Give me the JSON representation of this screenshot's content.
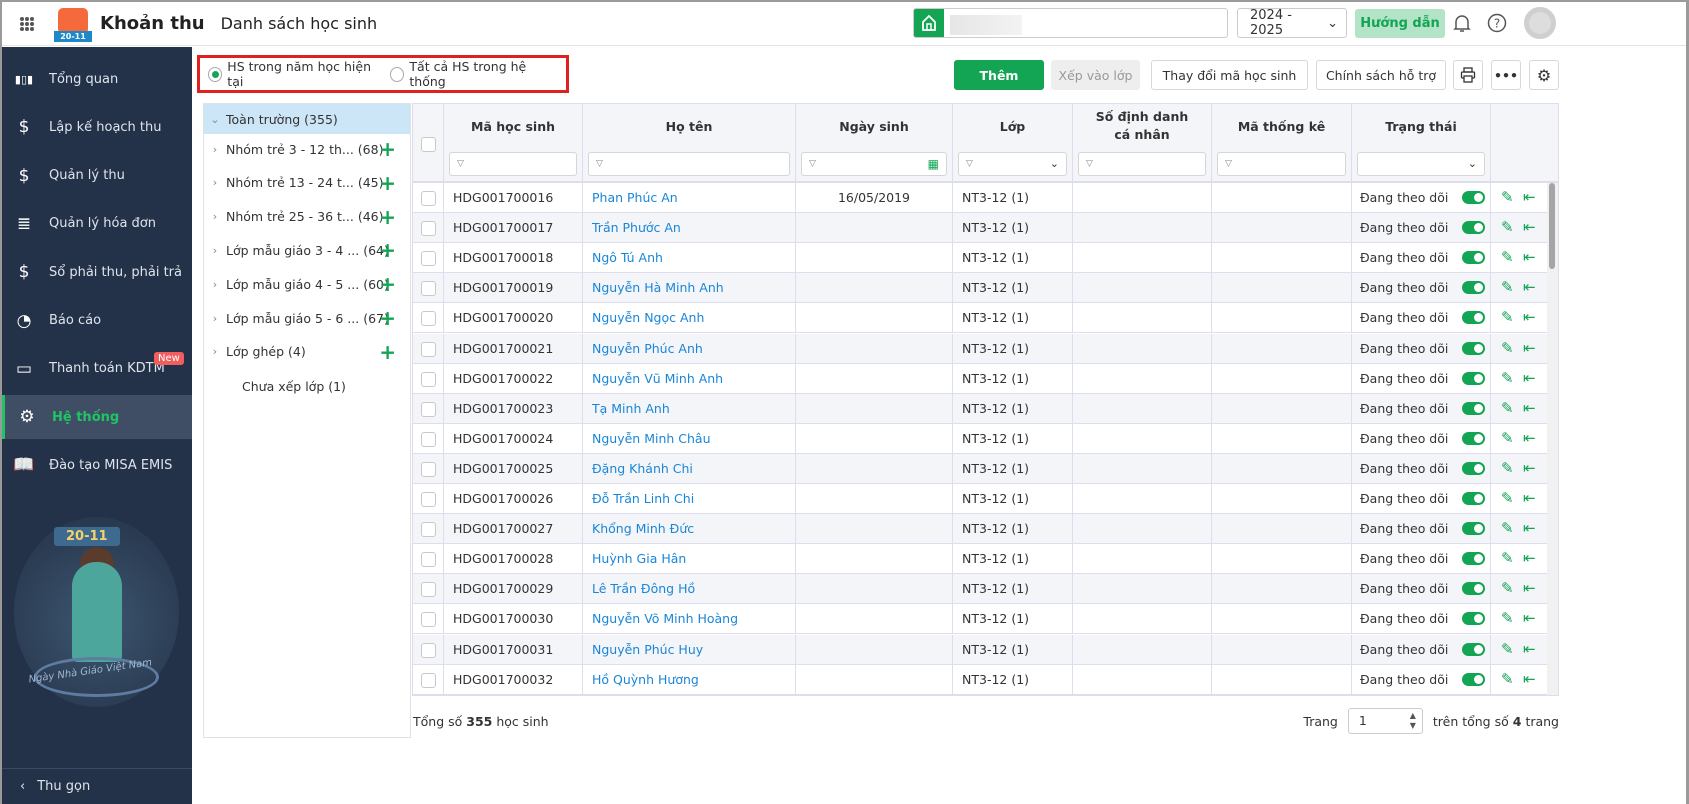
{
  "header": {
    "app_title": "Khoản thu",
    "page_title": "Danh sách học sinh",
    "logo_text": "20-11",
    "school_year": "2024 - 2025",
    "guide_label": "Hướng dẫn"
  },
  "sidebar": {
    "items": [
      {
        "label": "Tổng quan",
        "icon": "chart-bars-icon"
      },
      {
        "label": "Lập kế hoạch thu",
        "icon": "calendar-dollar-icon"
      },
      {
        "label": "Quản lý thu",
        "icon": "hand-coin-icon"
      },
      {
        "label": "Quản lý hóa đơn",
        "icon": "invoice-icon"
      },
      {
        "label": "Sổ phải thu, phải trả",
        "icon": "ledger-icon"
      },
      {
        "label": "Báo cáo",
        "icon": "pie-chart-icon"
      },
      {
        "label": "Thanh toán KDTM",
        "icon": "card-check-icon",
        "badge": "New"
      },
      {
        "label": "Hệ thống",
        "icon": "gear-icon",
        "active": true
      },
      {
        "label": "Đào tạo MISA EMIS",
        "icon": "book-icon"
      }
    ],
    "illustration_text": "Ngày Nhà Giáo Việt Nam",
    "illustration_badge": "20-11",
    "collapse_label": "Thu gọn"
  },
  "filter": {
    "options": [
      "HS trong năm học hiện tại",
      "Tất cả HS trong hệ thống"
    ],
    "selected": 0
  },
  "toolbar": {
    "add": "Thêm",
    "assign_class": "Xếp vào lớp",
    "change_code": "Thay đổi mã học sinh",
    "support_policy": "Chính sách hỗ trợ"
  },
  "tree": {
    "root": "Toàn trường (355)",
    "nodes": [
      {
        "label": "Nhóm trẻ 3 - 12 th...",
        "count": "(68)"
      },
      {
        "label": "Nhóm trẻ 13 - 24 t...",
        "count": "(45)"
      },
      {
        "label": "Nhóm trẻ 25 - 36 t...",
        "count": "(46)"
      },
      {
        "label": "Lớp mẫu giáo 3 - 4 ...",
        "count": "(64)"
      },
      {
        "label": "Lớp mẫu giáo 4 - 5 ...",
        "count": "(60)"
      },
      {
        "label": "Lớp mẫu giáo 5 - 6 ...",
        "count": "(67)"
      },
      {
        "label": "Lớp ghép",
        "count": "(4)"
      }
    ],
    "unassigned": "Chưa xếp lớp (1)"
  },
  "table": {
    "columns": [
      "Mã học sinh",
      "Họ tên",
      "Ngày sinh",
      "Lớp",
      "Số định danh cá nhân",
      "Mã thống kê",
      "Trạng thái"
    ],
    "status_filter_value": "",
    "rows": [
      {
        "code": "HDG001700016",
        "name": "Phan Phúc An",
        "dob": "16/05/2019",
        "class": "NT3-12 (1)",
        "status": "Đang theo dõi"
      },
      {
        "code": "HDG001700017",
        "name": "Trần Phước An",
        "dob": "",
        "class": "NT3-12 (1)",
        "status": "Đang theo dõi"
      },
      {
        "code": "HDG001700018",
        "name": "Ngô Tú Anh",
        "dob": "",
        "class": "NT3-12 (1)",
        "status": "Đang theo dõi"
      },
      {
        "code": "HDG001700019",
        "name": "Nguyễn Hà Minh Anh",
        "dob": "",
        "class": "NT3-12 (1)",
        "status": "Đang theo dõi"
      },
      {
        "code": "HDG001700020",
        "name": "Nguyễn Ngọc Anh",
        "dob": "",
        "class": "NT3-12 (1)",
        "status": "Đang theo dõi"
      },
      {
        "code": "HDG001700021",
        "name": "Nguyễn Phúc Anh",
        "dob": "",
        "class": "NT3-12 (1)",
        "status": "Đang theo dõi"
      },
      {
        "code": "HDG001700022",
        "name": "Nguyễn Vũ Minh Anh",
        "dob": "",
        "class": "NT3-12 (1)",
        "status": "Đang theo dõi"
      },
      {
        "code": "HDG001700023",
        "name": "Tạ Minh Anh",
        "dob": "",
        "class": "NT3-12 (1)",
        "status": "Đang theo dõi"
      },
      {
        "code": "HDG001700024",
        "name": "Nguyễn Minh Châu",
        "dob": "",
        "class": "NT3-12 (1)",
        "status": "Đang theo dõi"
      },
      {
        "code": "HDG001700025",
        "name": "Đặng Khánh Chi",
        "dob": "",
        "class": "NT3-12 (1)",
        "status": "Đang theo dõi"
      },
      {
        "code": "HDG001700026",
        "name": "Đỗ Trần Linh Chi",
        "dob": "",
        "class": "NT3-12 (1)",
        "status": "Đang theo dõi"
      },
      {
        "code": "HDG001700027",
        "name": "Khổng Minh Đức",
        "dob": "",
        "class": "NT3-12 (1)",
        "status": "Đang theo dõi"
      },
      {
        "code": "HDG001700028",
        "name": "Huỳnh Gia Hân",
        "dob": "",
        "class": "NT3-12 (1)",
        "status": "Đang theo dõi"
      },
      {
        "code": "HDG001700029",
        "name": "Lê Trần Đông Hồ",
        "dob": "",
        "class": "NT3-12 (1)",
        "status": "Đang theo dõi"
      },
      {
        "code": "HDG001700030",
        "name": "Nguyễn Võ Minh Hoàng",
        "dob": "",
        "class": "NT3-12 (1)",
        "status": "Đang theo dõi"
      },
      {
        "code": "HDG001700031",
        "name": "Nguyễn Phúc Huy",
        "dob": "",
        "class": "NT3-12 (1)",
        "status": "Đang theo dõi"
      },
      {
        "code": "HDG001700032",
        "name": "Hồ Quỳnh Hương",
        "dob": "",
        "class": "NT3-12 (1)",
        "status": "Đang theo dõi"
      }
    ]
  },
  "footer": {
    "total_prefix": "Tổng số",
    "total": "355",
    "total_suffix": "học sinh",
    "page_label": "Trang",
    "page": "1",
    "of_prefix": "trên tổng số",
    "pages": "4",
    "of_suffix": "trang"
  },
  "colors": {
    "accent": "#13a454",
    "sidebar": "#233249",
    "link": "#1a86d8",
    "highlight": "#e02020"
  }
}
